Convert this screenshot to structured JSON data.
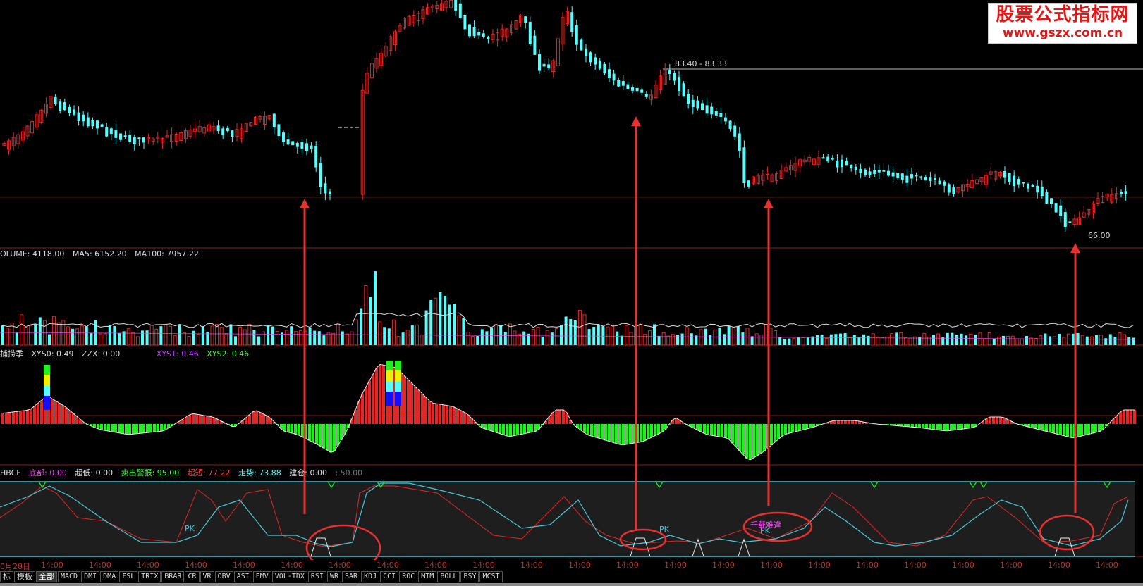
{
  "colors": {
    "up": "#e02828",
    "down": "#54ffff",
    "green": "#22ee22",
    "grid": "#8a2020",
    "white": "#ffffff",
    "yellow": "#f0f000",
    "blue": "#1010ff",
    "arrow": "#e83030",
    "magenta": "#ff44ff",
    "cyan_line": "#48c8d8"
  },
  "main": {
    "price_label_high": "83.40 - 83.33",
    "price_label_low": "66.00"
  },
  "volume": {
    "label": "OLUME:",
    "value": "4118.00",
    "ma5_label": "MA5:",
    "ma5": "6152.20",
    "ma100_label": "MA100:",
    "ma100": "7957.22"
  },
  "ind1": {
    "name": "捕捞季",
    "xys0_label": "XYS0:",
    "xys0": "0.49",
    "zzx_label": "ZZX:",
    "zzx": "0.00",
    "xys1_label": "XYS1:",
    "xys1": "0.46",
    "xys2_label": "XYS2:",
    "xys2": "0.46"
  },
  "ind2": {
    "name": "HBCF",
    "dibu_label": "底部:",
    "dibu": "0.00",
    "chaodi_label": "超低:",
    "chaodi": "0.00",
    "maichu_label": "卖出警报:",
    "maichu": "95.00",
    "chaozhui_label": "超短:",
    "chaozhui": "77.22",
    "zoushi_label": "走势:",
    "zoushi": "73.88",
    "jiancang_label": "建仓:",
    "jiancang": "0.00",
    "level": ": 50.00",
    "pk_label": "PK",
    "qianzai_label": "千载难逢"
  },
  "watermark": {
    "line1": "股票公式指标网",
    "line2": "www.gszx.com.cn"
  },
  "time_axis": {
    "first": "0月28日",
    "ticks": [
      "14:00",
      "14:00",
      "14:00",
      "14:00",
      "14:00",
      "14:00",
      "14:00",
      "14:00",
      "14:00",
      "14:00",
      "14:00",
      "14:00",
      "14:00",
      "14:00",
      "14:00",
      "14:00",
      "14:00",
      "14:00",
      "14:00",
      "14:00",
      "14:00",
      "14:00",
      "14:00"
    ]
  },
  "tabs": [
    "标",
    "模板",
    "全部",
    "MACD",
    "DMI",
    "DMA",
    "FSL",
    "TRIX",
    "BRAR",
    "CR",
    "VR",
    "OBV",
    "ASI",
    "EMV",
    "VOL-TDX",
    "RSI",
    "WR",
    "SAR",
    "KDJ",
    "CCI",
    "ROC",
    "MTM",
    "BOLL",
    "PSY",
    "MCST"
  ],
  "selected_tab": "全部"
}
